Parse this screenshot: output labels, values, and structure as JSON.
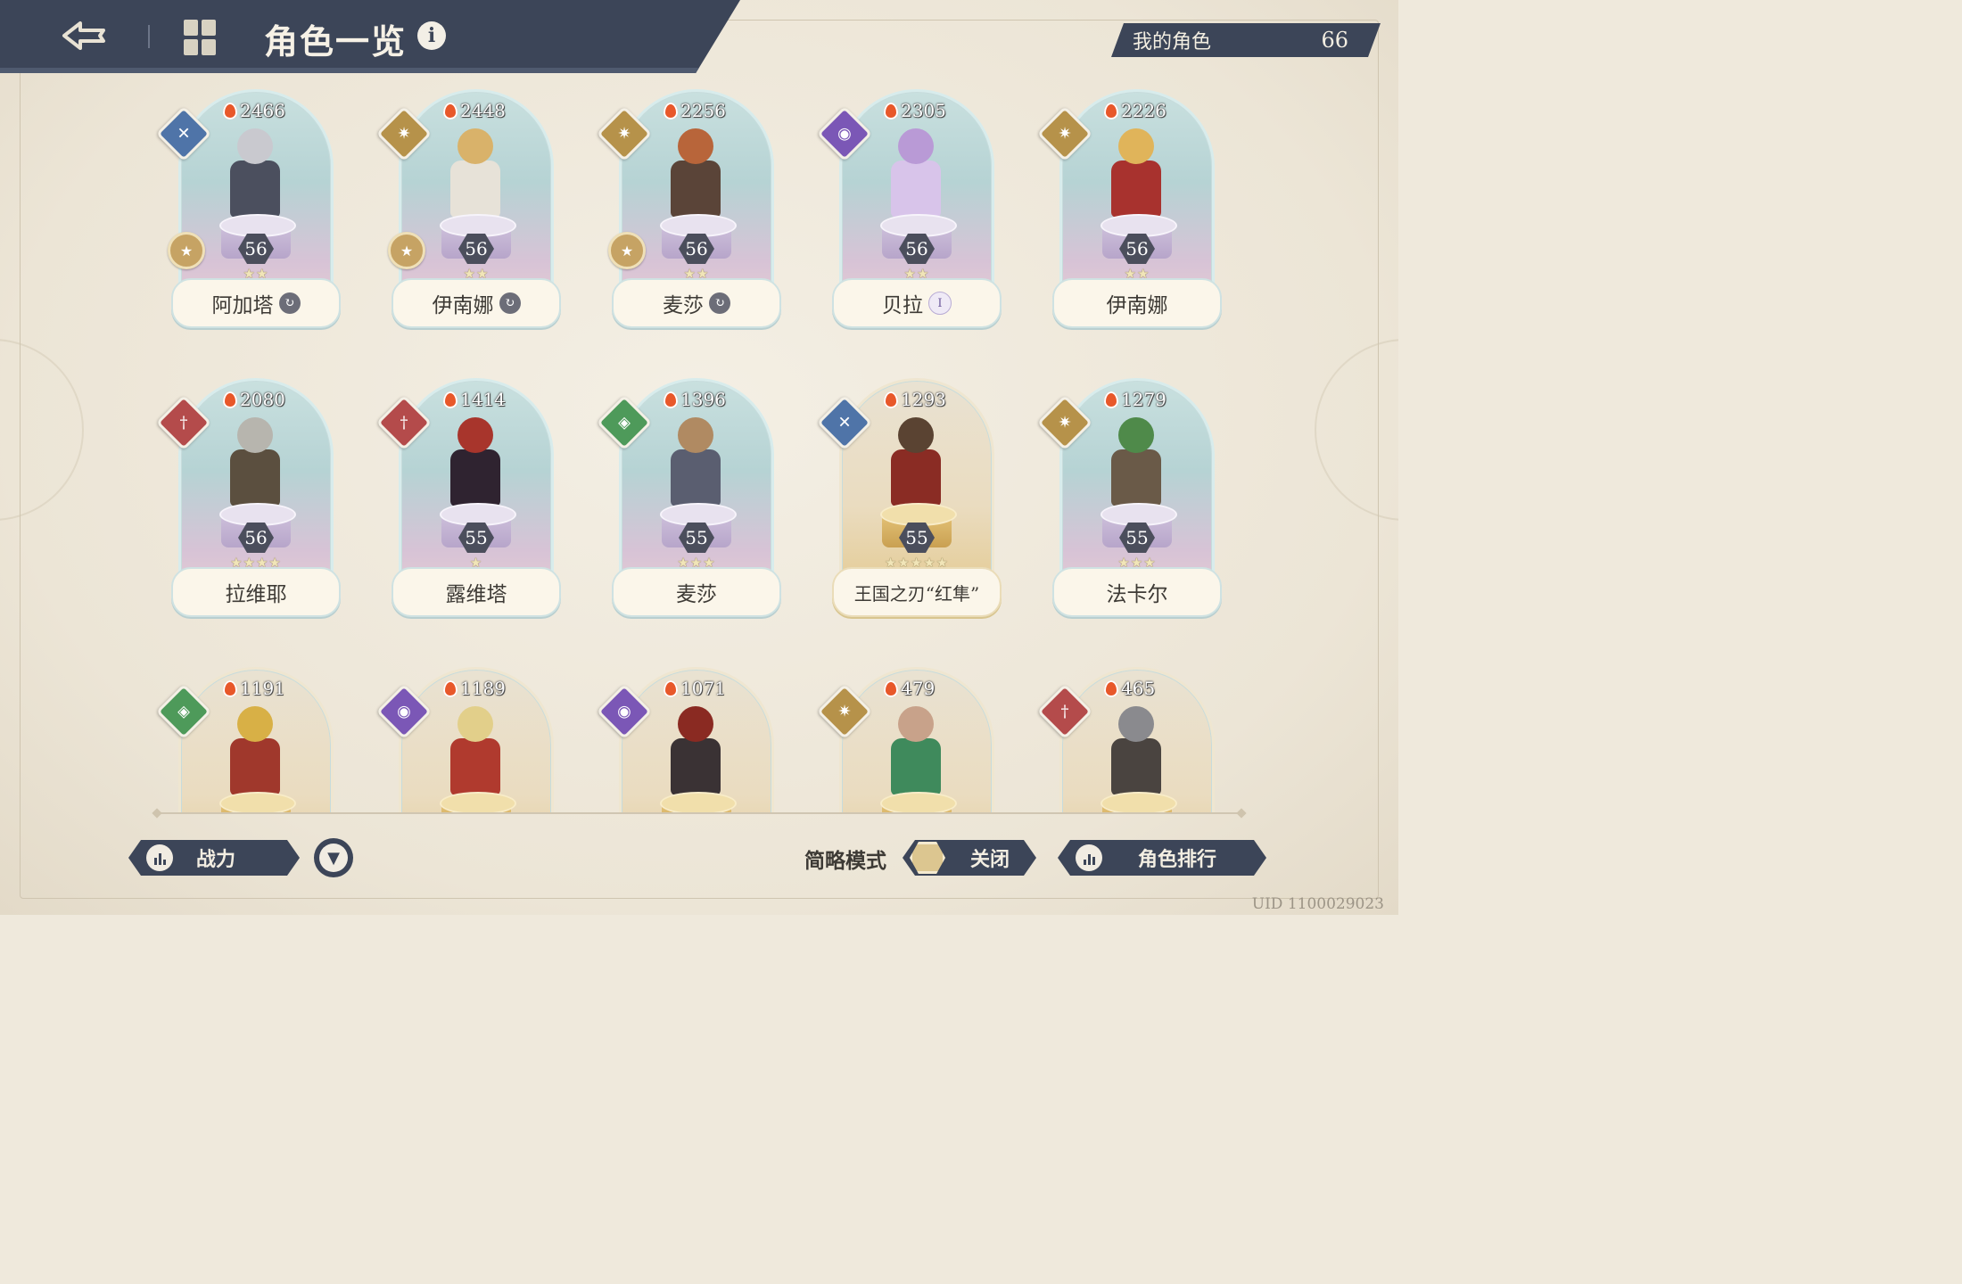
{
  "header": {
    "title": "角色一览",
    "info_icon": "info-icon",
    "back_icon": "back-arrow-icon",
    "menu_icon": "menu-grid-icon"
  },
  "owned": {
    "label": "我的角色",
    "count": "66"
  },
  "characters": [
    {
      "name": "阿加塔",
      "power": "2466",
      "level": "56",
      "stars": "★★",
      "element": "blue",
      "element_icon": "wind-icon",
      "badge": "↻",
      "style": "normal",
      "rank_coin": true
    },
    {
      "name": "伊南娜",
      "power": "2448",
      "level": "56",
      "stars": "★★",
      "element": "gold",
      "element_icon": "light-icon",
      "badge": "↻",
      "style": "normal",
      "rank_coin": true
    },
    {
      "name": "麦莎",
      "power": "2256",
      "level": "56",
      "stars": "★★",
      "element": "gold",
      "element_icon": "light-icon",
      "badge": "↻",
      "style": "normal",
      "rank_coin": true
    },
    {
      "name": "贝拉",
      "power": "2305",
      "level": "56",
      "stars": "★★",
      "element": "purple",
      "element_icon": "dark-icon",
      "badge": "I",
      "badge_type": "roman",
      "style": "normal",
      "rank_coin": false
    },
    {
      "name": "伊南娜",
      "power": "2226",
      "level": "56",
      "stars": "★★",
      "element": "gold",
      "element_icon": "light-icon",
      "badge": "",
      "style": "normal",
      "rank_coin": false
    },
    {
      "name": "拉维耶",
      "power": "2080",
      "level": "56",
      "stars": "★★★★",
      "element": "red",
      "element_icon": "fire-sword-icon",
      "badge": "",
      "style": "normal",
      "rank_coin": false
    },
    {
      "name": "露维塔",
      "power": "1414",
      "level": "55",
      "stars": "★",
      "element": "red",
      "element_icon": "fire-sword-icon",
      "badge": "",
      "style": "normal",
      "rank_coin": false
    },
    {
      "name": "麦莎",
      "power": "1396",
      "level": "55",
      "stars": "★★★",
      "element": "green",
      "element_icon": "nature-shield-icon",
      "badge": "",
      "style": "normal",
      "rank_coin": false
    },
    {
      "name": "王国之刃“红隼”",
      "power": "1293",
      "level": "55",
      "stars": "★★★★★",
      "element": "blue",
      "element_icon": "wind-icon",
      "badge": "",
      "style": "gold",
      "rank_coin": false
    },
    {
      "name": "法卡尔",
      "power": "1279",
      "level": "55",
      "stars": "★★★",
      "element": "gold",
      "element_icon": "light-icon",
      "badge": "",
      "style": "normal",
      "rank_coin": false
    },
    {
      "name": "",
      "power": "1191",
      "level": "",
      "stars": "",
      "element": "green",
      "element_icon": "nature-shield-icon",
      "badge": "",
      "style": "gold",
      "rank_coin": false
    },
    {
      "name": "",
      "power": "1189",
      "level": "",
      "stars": "",
      "element": "purple",
      "element_icon": "dark-icon",
      "badge": "",
      "style": "gold",
      "rank_coin": false
    },
    {
      "name": "",
      "power": "1071",
      "level": "",
      "stars": "",
      "element": "purple",
      "element_icon": "dark-icon",
      "badge": "",
      "style": "gold",
      "rank_coin": false
    },
    {
      "name": "",
      "power": "479",
      "level": "",
      "stars": "",
      "element": "gold",
      "element_icon": "light-icon",
      "badge": "",
      "style": "gold",
      "rank_coin": false
    },
    {
      "name": "",
      "power": "465",
      "level": "",
      "stars": "",
      "element": "red",
      "element_icon": "fire-sword-icon",
      "badge": "",
      "style": "gold",
      "rank_coin": false
    }
  ],
  "bottom": {
    "sort_label": "战力",
    "simple_mode_label": "简略模式",
    "simple_mode_value": "关闭",
    "ranking_label": "角色排行",
    "uid": "UID 1100029023"
  },
  "colors": {
    "navy": "#3c4558",
    "cream": "#efe9dc",
    "accent_gold": "#c6a364"
  }
}
